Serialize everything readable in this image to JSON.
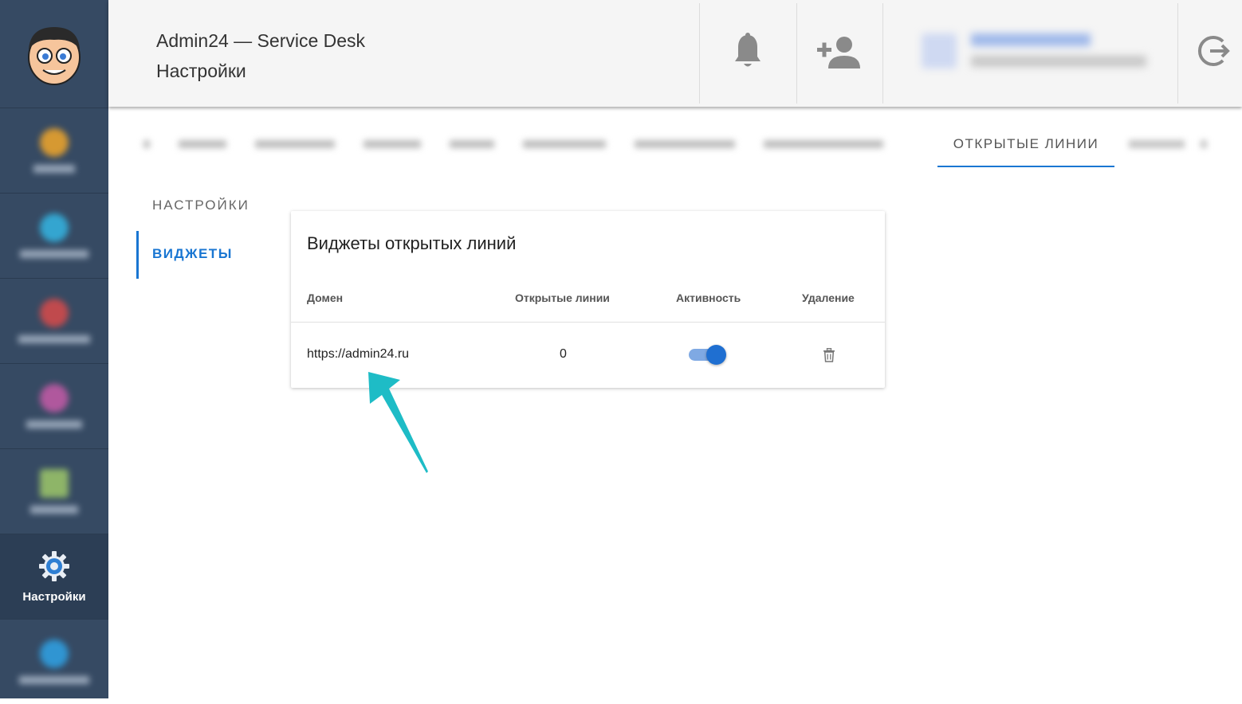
{
  "header": {
    "app_title": "Admin24 — Service Desk",
    "page_title": "Настройки"
  },
  "sidebar": {
    "active_label": "Настройки"
  },
  "tabs": {
    "active_label": "ОТКРЫТЫЕ ЛИНИИ"
  },
  "settings_menu": {
    "settings_label": "НАСТРОЙКИ",
    "widgets_label": "ВИДЖЕТЫ"
  },
  "card": {
    "title": "Виджеты открытых линий",
    "columns": [
      "Домен",
      "Открытые линии",
      "Активность",
      "Удаление"
    ],
    "rows": [
      {
        "domain": "https://admin24.ru",
        "open_lines": "0",
        "active": true
      }
    ]
  },
  "colors": {
    "sidebar_bg": "#364a63",
    "accent": "#1976d2",
    "arrow": "#1ebcc6"
  }
}
